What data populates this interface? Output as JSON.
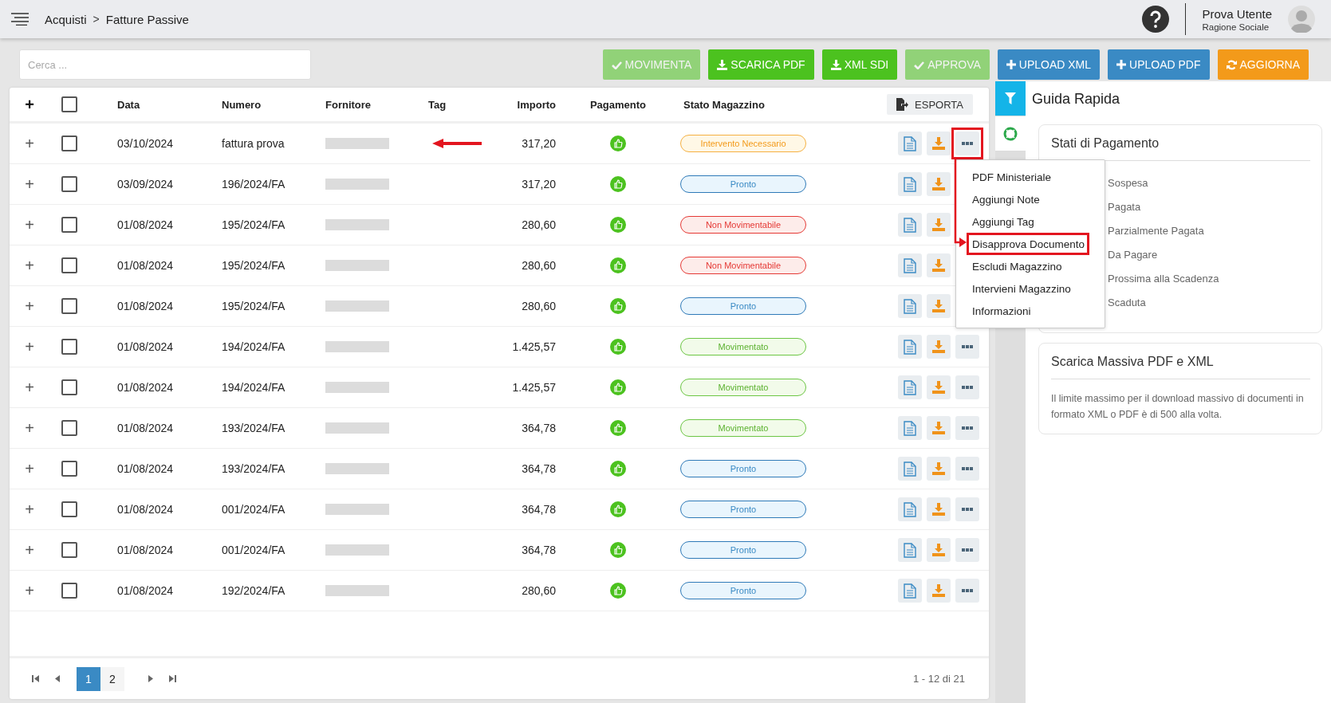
{
  "breadcrumb": [
    "Acquisti",
    "Fatture Passive"
  ],
  "breadcrumb_separator": ">",
  "user": {
    "name": "Prova Utente",
    "company": "Ragione Sociale"
  },
  "search": {
    "placeholder": "Cerca ..."
  },
  "toolbar": [
    {
      "label": "MOVIMENTA",
      "kind": "approve",
      "disabled": true
    },
    {
      "label": "SCARICA PDF",
      "kind": "download",
      "disabled": false
    },
    {
      "label": "XML SDI",
      "kind": "download",
      "disabled": false
    },
    {
      "label": "APPROVA",
      "kind": "approve",
      "disabled": true
    },
    {
      "label": "UPLOAD XML",
      "kind": "upload",
      "disabled": false
    },
    {
      "label": "UPLOAD PDF",
      "kind": "upload",
      "disabled": false
    },
    {
      "label": "AGGIORNA",
      "kind": "refresh",
      "disabled": false
    }
  ],
  "table": {
    "expand_all": "+",
    "select_all_checked": false,
    "columns": [
      "Data",
      "Numero",
      "Fornitore",
      "Tag",
      "Importo",
      "Pagamento",
      "Stato Magazzino"
    ],
    "export": "ESPORTA",
    "rows": [
      {
        "date": "03/10/2024",
        "number": "fattura prova",
        "amount": "317,20",
        "status": "Intervento Necessario",
        "kind": "warning",
        "checked": false,
        "tag_marked": true,
        "menu_marked": true
      },
      {
        "date": "03/09/2024",
        "number": "196/2024/FA",
        "amount": "317,20",
        "status": "Pronto",
        "kind": "info",
        "checked": false,
        "tag_marked": false,
        "menu_marked": false
      },
      {
        "date": "01/08/2024",
        "number": "195/2024/FA",
        "amount": "280,60",
        "status": "Non Movimentabile",
        "kind": "error",
        "checked": false,
        "tag_marked": false,
        "menu_marked": false
      },
      {
        "date": "01/08/2024",
        "number": "195/2024/FA",
        "amount": "280,60",
        "status": "Non Movimentabile",
        "kind": "error",
        "checked": false,
        "tag_marked": false,
        "menu_marked": false
      },
      {
        "date": "01/08/2024",
        "number": "195/2024/FA",
        "amount": "280,60",
        "status": "Pronto",
        "kind": "info",
        "checked": false,
        "tag_marked": false,
        "menu_marked": false
      },
      {
        "date": "01/08/2024",
        "number": "194/2024/FA",
        "amount": "1.425,57",
        "status": "Movimentato",
        "kind": "success",
        "checked": false,
        "tag_marked": false,
        "menu_marked": false
      },
      {
        "date": "01/08/2024",
        "number": "194/2024/FA",
        "amount": "1.425,57",
        "status": "Movimentato",
        "kind": "success",
        "checked": false,
        "tag_marked": false,
        "menu_marked": false
      },
      {
        "date": "01/08/2024",
        "number": "193/2024/FA",
        "amount": "364,78",
        "status": "Movimentato",
        "kind": "success",
        "checked": false,
        "tag_marked": false,
        "menu_marked": false
      },
      {
        "date": "01/08/2024",
        "number": "193/2024/FA",
        "amount": "364,78",
        "status": "Pronto",
        "kind": "info",
        "checked": false,
        "tag_marked": false,
        "menu_marked": false
      },
      {
        "date": "01/08/2024",
        "number": "001/2024/FA",
        "amount": "364,78",
        "status": "Pronto",
        "kind": "info",
        "checked": false,
        "tag_marked": false,
        "menu_marked": false
      },
      {
        "date": "01/08/2024",
        "number": "001/2024/FA",
        "amount": "364,78",
        "status": "Pronto",
        "kind": "info",
        "checked": false,
        "tag_marked": false,
        "menu_marked": false
      },
      {
        "date": "01/08/2024",
        "number": "192/2024/FA",
        "amount": "280,60",
        "status": "Pronto",
        "kind": "info",
        "checked": false,
        "tag_marked": false,
        "menu_marked": false
      }
    ]
  },
  "pagination": {
    "pages": [
      {
        "label": "1",
        "selected": true
      },
      {
        "label": "2",
        "selected": false
      }
    ],
    "summary": "1 - 12 di 21"
  },
  "context_menu": {
    "items": [
      {
        "label": "PDF Ministeriale",
        "highlighted": false
      },
      {
        "label": "Aggiungi Note",
        "highlighted": false
      },
      {
        "label": "Aggiungi Tag",
        "highlighted": false
      },
      {
        "label": "Disapprova Documento",
        "highlighted": true
      },
      {
        "label": "Escludi Magazzino",
        "highlighted": false
      },
      {
        "label": "Intervieni Magazzino",
        "highlighted": false
      },
      {
        "label": "Informazioni",
        "highlighted": false
      }
    ]
  },
  "side_tabs": [
    {
      "kind": "filter",
      "selected": true
    },
    {
      "kind": "help",
      "selected": false
    }
  ],
  "guide": {
    "title": "Guida Rapida",
    "cards": [
      {
        "title": "Stati di Pagamento",
        "items": [
          "Sospesa",
          "Pagata",
          "Parzialmente Pagata",
          "Da Pagare",
          "Prossima alla Scadenza",
          "Scaduta"
        ]
      },
      {
        "title": "Scarica Massiva PDF e XML",
        "text": "Il limite massimo per il download massivo di documenti in formato XML o PDF è di 500 alla volta."
      }
    ]
  }
}
